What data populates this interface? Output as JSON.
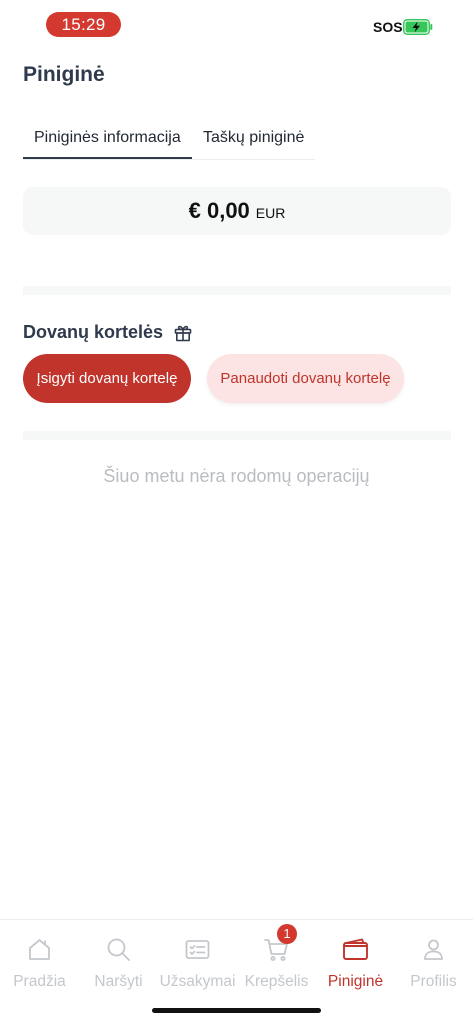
{
  "status_bar": {
    "time": "15:29",
    "sos": "SOS",
    "battery_icon": "battery-charging-icon"
  },
  "header": {
    "title": "Piniginė"
  },
  "tabs": [
    {
      "label": "Piniginės informacija",
      "active": true
    },
    {
      "label": "Taškų piniginė",
      "active": false
    }
  ],
  "balance": {
    "amount": "€ 0,00",
    "currency": "EUR"
  },
  "gift_cards": {
    "title": "Dovanų kortelės",
    "icon": "gift-icon",
    "buy_label": "Įsigyti dovanų kortelę",
    "redeem_label": "Panaudoti dovanų kortelę"
  },
  "operations": {
    "empty_text": "Šiuo metu nėra rodomų operacijų"
  },
  "nav": {
    "items": [
      {
        "label": "Pradžia",
        "icon": "home-icon"
      },
      {
        "label": "Naršyti",
        "icon": "search-icon"
      },
      {
        "label": "Užsakymai",
        "icon": "orders-icon"
      },
      {
        "label": "Krepšelis",
        "icon": "cart-icon",
        "badge": "1"
      },
      {
        "label": "Piniginė",
        "icon": "wallet-icon",
        "active": true
      },
      {
        "label": "Profilis",
        "icon": "profile-icon"
      }
    ]
  },
  "colors": {
    "accent": "#c0342c",
    "accent_light": "#fbe4e3",
    "inactive": "#c4c7cc",
    "text": "#2f3a4c"
  }
}
